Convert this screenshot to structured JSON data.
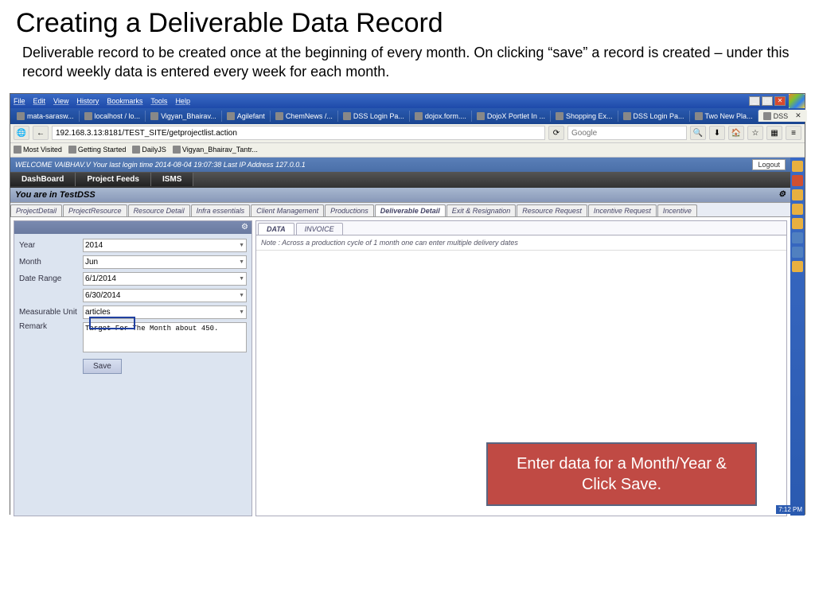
{
  "slide": {
    "title": "Creating a Deliverable Data Record",
    "subtitle": "Deliverable record to be created  once at the beginning of every month. On clicking “save” a record is created – under this record weekly data is entered every week for each month."
  },
  "win_menu": [
    "File",
    "Edit",
    "View",
    "History",
    "Bookmarks",
    "Tools",
    "Help"
  ],
  "browser_tabs": [
    "mata-sarasw...",
    "localhost / lo...",
    "Vigyan_Bhairav...",
    "Agilefant",
    "ChemNews /...",
    "DSS Login Pa...",
    "dojox.form....",
    "DojoX Portlet In ...",
    "Shopping Ex...",
    "DSS Login Pa...",
    "Two New Pla..."
  ],
  "active_tab": "DSS",
  "url": "192.168.3.13:8181/TEST_SITE/getprojectlist.action",
  "search_placeholder": "Google",
  "bookmarks": [
    "Most Visited",
    "Getting Started",
    "DailyJS",
    "Vigyan_Bhairav_Tantr..."
  ],
  "welcome": "WELCOME  VAIBHAV.V  Your last login time 2014-08-04 19:07:38 Last IP Address 127.0.0.1",
  "logout": "Logout",
  "nav_items": [
    "DashBoard",
    "Project Feeds",
    "ISMS"
  ],
  "location": "You are in TestDSS",
  "inner_tabs": [
    "ProjectDetail",
    "ProjectResource",
    "Resource Detail",
    "Infra essentials",
    "Client Management",
    "Productions",
    "Deliverable Detail",
    "Exit & Resignation",
    "Resource Request",
    "Incentive Request",
    "Incentive"
  ],
  "active_inner_tab": "Deliverable Detail",
  "form": {
    "year_label": "Year",
    "year": "2014",
    "month_label": "Month",
    "month": "Jun",
    "range_label": "Date Range",
    "range_start": "6/1/2014",
    "range_end": "6/30/2014",
    "unit_label": "Measurable Unit",
    "unit": "articles",
    "remark_label": "Remark",
    "remark": "Target For The Month about 450.",
    "save": "Save"
  },
  "detail_tabs": [
    "DATA",
    "INVOICE"
  ],
  "active_detail_tab": "DATA",
  "detail_note": "Note : Across a production cycle of 1 month one can enter multiple delivery dates",
  "clock": "7:12 PM",
  "callout": "Enter data for a Month/Year & Click Save."
}
